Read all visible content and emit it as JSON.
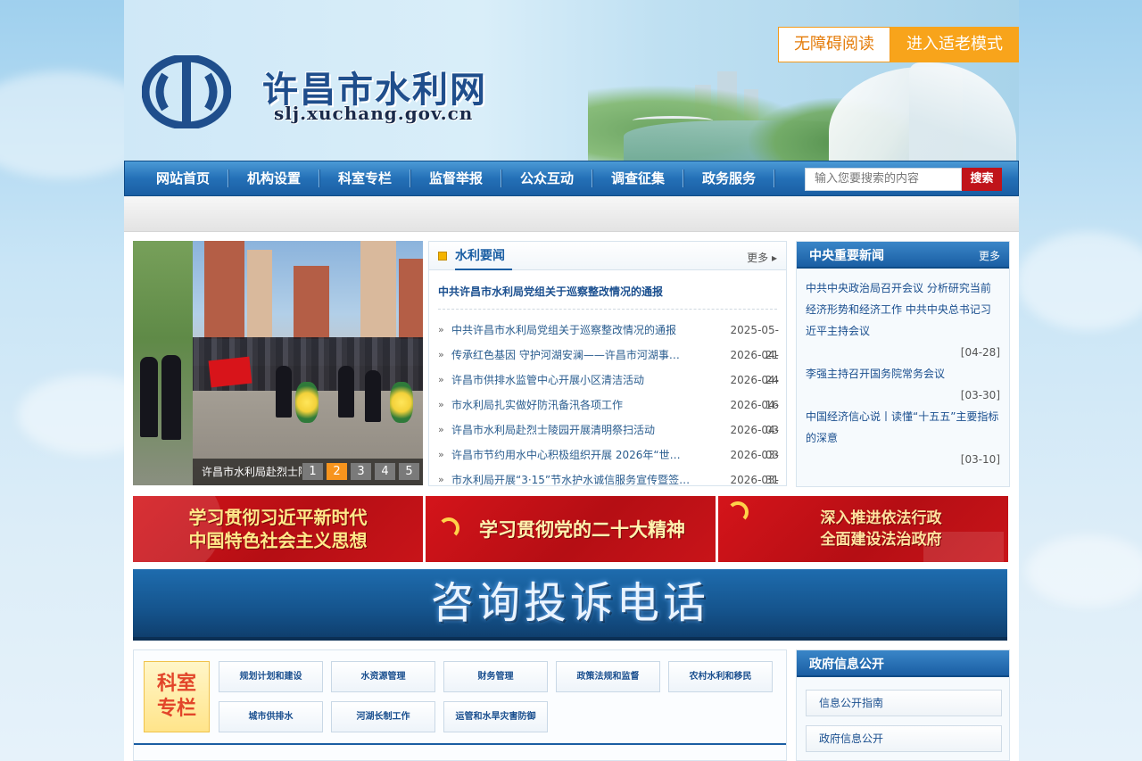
{
  "header": {
    "title": "许昌市水利网",
    "domain": "slj.xuchang.gov.cn",
    "accessible_label": "无障碍阅读",
    "elder_mode_label": "进入适老模式"
  },
  "nav": {
    "items": [
      "网站首页",
      "机构设置",
      "科室专栏",
      "监督举报",
      "公众互动",
      "调查征集",
      "政务服务"
    ],
    "search_placeholder": "输入您要搜索的内容",
    "search_button": "搜索"
  },
  "slider": {
    "caption": "许昌市水利局赴烈士陵",
    "pages": [
      "1",
      "2",
      "3",
      "4",
      "5"
    ],
    "active_page": 2
  },
  "news": {
    "title": "水利要闻",
    "more": "更多",
    "headline": "中共许昌市水利局党组关于巡察整改情况的通报",
    "items": [
      {
        "title": "中共许昌市水利局党组关于巡察整改情况的通报",
        "date": "2025-05-21"
      },
      {
        "title": "传承红色基因 守护河湖安澜——许昌市河湖事…",
        "date": "2026-04-24"
      },
      {
        "title": "许昌市供排水监管中心开展小区清洁活动",
        "date": "2026-04-16"
      },
      {
        "title": "市水利局扎实做好防汛备汛各项工作",
        "date": "2026-04-03"
      },
      {
        "title": "许昌市水利局赴烈士陵园开展清明祭扫活动",
        "date": "2026-04-03"
      },
      {
        "title": "许昌市节约用水中心积极组织开展 2026年“世…",
        "date": "2026-03-31"
      },
      {
        "title": "市水利局开展“3·15”节水护水诚信服务宣传暨签…",
        "date": "2026-03-13"
      }
    ]
  },
  "central": {
    "title": "中央重要新闻",
    "more": "更多",
    "items": [
      {
        "title": "中共中央政治局召开会议 分析研究当前经济形势和经济工作 中共中央总书记习近平主持会议",
        "date": "[04-28]"
      },
      {
        "title": "李强主持召开国务院常务会议",
        "date": "[03-30]"
      },
      {
        "title": "中国经济信心说丨读懂“十五五”主要指标的深意",
        "date": "[03-10]"
      }
    ]
  },
  "banners": {
    "b1_line1": "学习贯彻习近平新时代",
    "b1_line2": "中国特色社会主义思想",
    "b2": "学习贯彻党的二十大精神",
    "b3_line1": "深入推进依法行政",
    "b3_line2": "全面建设法治政府"
  },
  "consult": {
    "text": "咨询投诉电话"
  },
  "departments": {
    "badge_line1": "科室",
    "badge_line2": "专栏",
    "items": [
      "规划计划和建设",
      "水资源管理",
      "财务管理",
      "政策法规和监督",
      "农村水利和移民",
      "城市供排水",
      "河湖长制工作",
      "运管和水旱灾害防御"
    ]
  },
  "govinfo": {
    "title": "政府信息公开",
    "links": [
      "信息公开指南",
      "政府信息公开"
    ]
  },
  "colors": {
    "brand_blue": "#1a5ea3",
    "accent_orange": "#f8a41b",
    "search_red": "#c0131a"
  }
}
